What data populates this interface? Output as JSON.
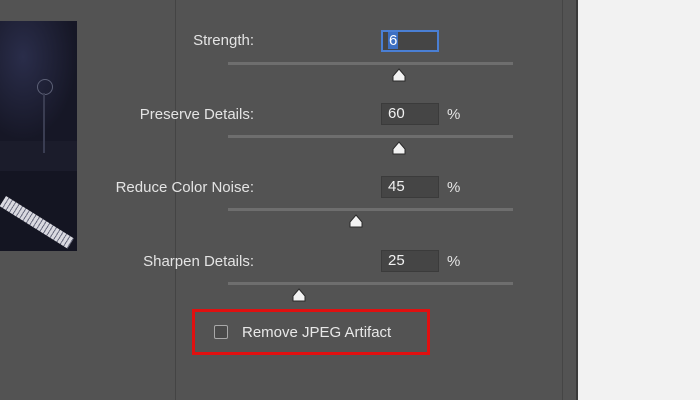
{
  "controls": {
    "strength": {
      "label": "Strength:",
      "value": "6",
      "level": 0.6
    },
    "preserve_details": {
      "label": "Preserve Details:",
      "value": "60",
      "unit": "%",
      "level": 0.6
    },
    "reduce_color_noise": {
      "label": "Reduce Color Noise:",
      "value": "45",
      "unit": "%",
      "level": 0.45
    },
    "sharpen_details": {
      "label": "Sharpen Details:",
      "value": "25",
      "unit": "%",
      "level": 0.25
    }
  },
  "checkbox": {
    "label": "Remove JPEG Artifact",
    "checked": false
  },
  "colors": {
    "highlight": "#e01010",
    "focus": "#4a7fd4",
    "panel": "#535353"
  }
}
